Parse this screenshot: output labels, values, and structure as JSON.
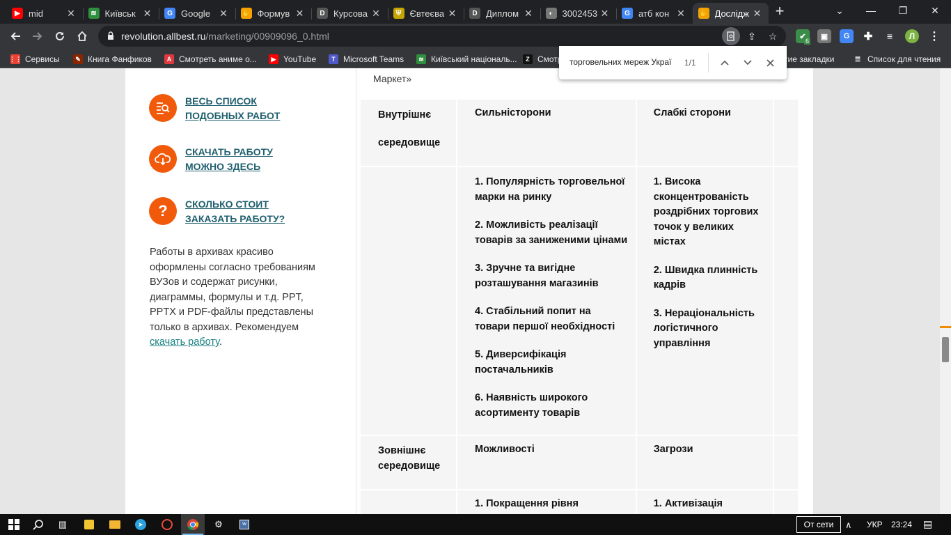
{
  "tabs": [
    {
      "title": "mid",
      "fav": "▶",
      "color": "#ff0000"
    },
    {
      "title": "Київськ",
      "fav": "≋",
      "color": "#2f8f3f"
    },
    {
      "title": "Google",
      "fav": "G",
      "color": "#4285f4"
    },
    {
      "title": "Формув",
      "fav": "✋",
      "color": "#f5a300"
    },
    {
      "title": "Курсова",
      "fav": "D",
      "color": "#555555"
    },
    {
      "title": "Євтеєва",
      "fav": "⛨",
      "color": "#c7a500"
    },
    {
      "title": "Диплом",
      "fav": "D",
      "color": "#555555"
    },
    {
      "title": "3002453",
      "fav": "◐",
      "color": "#777777"
    },
    {
      "title": "атб кон",
      "fav": "G",
      "color": "#4285f4"
    },
    {
      "title": "Дослідж",
      "fav": "✋",
      "color": "#f5a300"
    }
  ],
  "window": {
    "minimize": "—",
    "restore": "❐",
    "close": "✕",
    "dropdown": "⌄",
    "newtab": "+"
  },
  "address": {
    "host": "revolution.allbest.ru",
    "path": "/marketing/00909096_0.html"
  },
  "profile_initial": "Л",
  "extension_badge": "6",
  "bookmarks": [
    {
      "label": "Сервисы",
      "icon": "⋮⋮",
      "color": "#ea4335"
    },
    {
      "label": "Книга Фанфиков",
      "icon": "✎",
      "color": "#8b2500"
    },
    {
      "label": "Смотреть аниме о...",
      "icon": "A",
      "color": "#e0393e"
    },
    {
      "label": "YouTube",
      "icon": "▶",
      "color": "#ff0000"
    },
    {
      "label": "Microsoft Teams",
      "icon": "T",
      "color": "#5059c9"
    },
    {
      "label": "Київський національ...",
      "icon": "≋",
      "color": "#2f8f3f"
    },
    {
      "label": "Смотр",
      "icon": "Z",
      "color": "#111111"
    },
    {
      "label": "утие закладки",
      "icon": "",
      "color": "#35363a"
    },
    {
      "label": "Список для чтения",
      "icon": "☰",
      "color": "#35363a"
    }
  ],
  "find": {
    "query": "торговельних мереж Украї",
    "count": "1/1"
  },
  "sidebar": {
    "links": [
      {
        "line1": "ВЕСЬ СПИСОК",
        "line2": "ПОДОБНЫХ РАБОТ"
      },
      {
        "line1": "СКАЧАТЬ РАБОТУ",
        "line2": "МОЖНО ЗДЕСЬ"
      },
      {
        "line1": "СКОЛЬКО СТОИТ",
        "line2": "ЗАКАЗАТЬ РАБОТУ?"
      }
    ],
    "paragraph": "Работы в архивах красиво оформлены согласно требованиям ВУЗов и содержат рисунки, диаграммы, формулы и т.д. PPT, PPTX и PDF-файлы представлены только в архивах. Рекомендуем",
    "link_text": "скачать работу",
    "trail": "."
  },
  "table": {
    "caption": "Маркет»",
    "internal": {
      "label_line1": "Внутрішнє",
      "label_line2": "середовище",
      "strengths_header": "Сильністорони",
      "weaknesses_header": "Слабкі сторони",
      "strengths": [
        "1. Популярність торговельної марки на ринку",
        "2. Можливість реалізації товарів за заниженими цінами",
        "3. Зручне та вигідне розташування магазинів",
        "4. Стабільний попит на товари першої необхідності",
        "5. Диверсифікація постачальників",
        "6. Наявність широкого асортименту товарів"
      ],
      "weaknesses": [
        "1. Висока сконцентрованість роздрібних торгових точок у великих містах",
        "2. Швидка плинність кадрів",
        "3. Нераціональність логістичного управління"
      ]
    },
    "external": {
      "label": "Зовнішнє середовище",
      "opportunities_header": "Можливості",
      "threats_header": "Загрози",
      "opportunities_first": "1. Покращення рівня",
      "threats_first": "1. Активізація"
    }
  },
  "taskbar": {
    "network": "От сети",
    "lang": "УКР",
    "time": "23:24"
  }
}
